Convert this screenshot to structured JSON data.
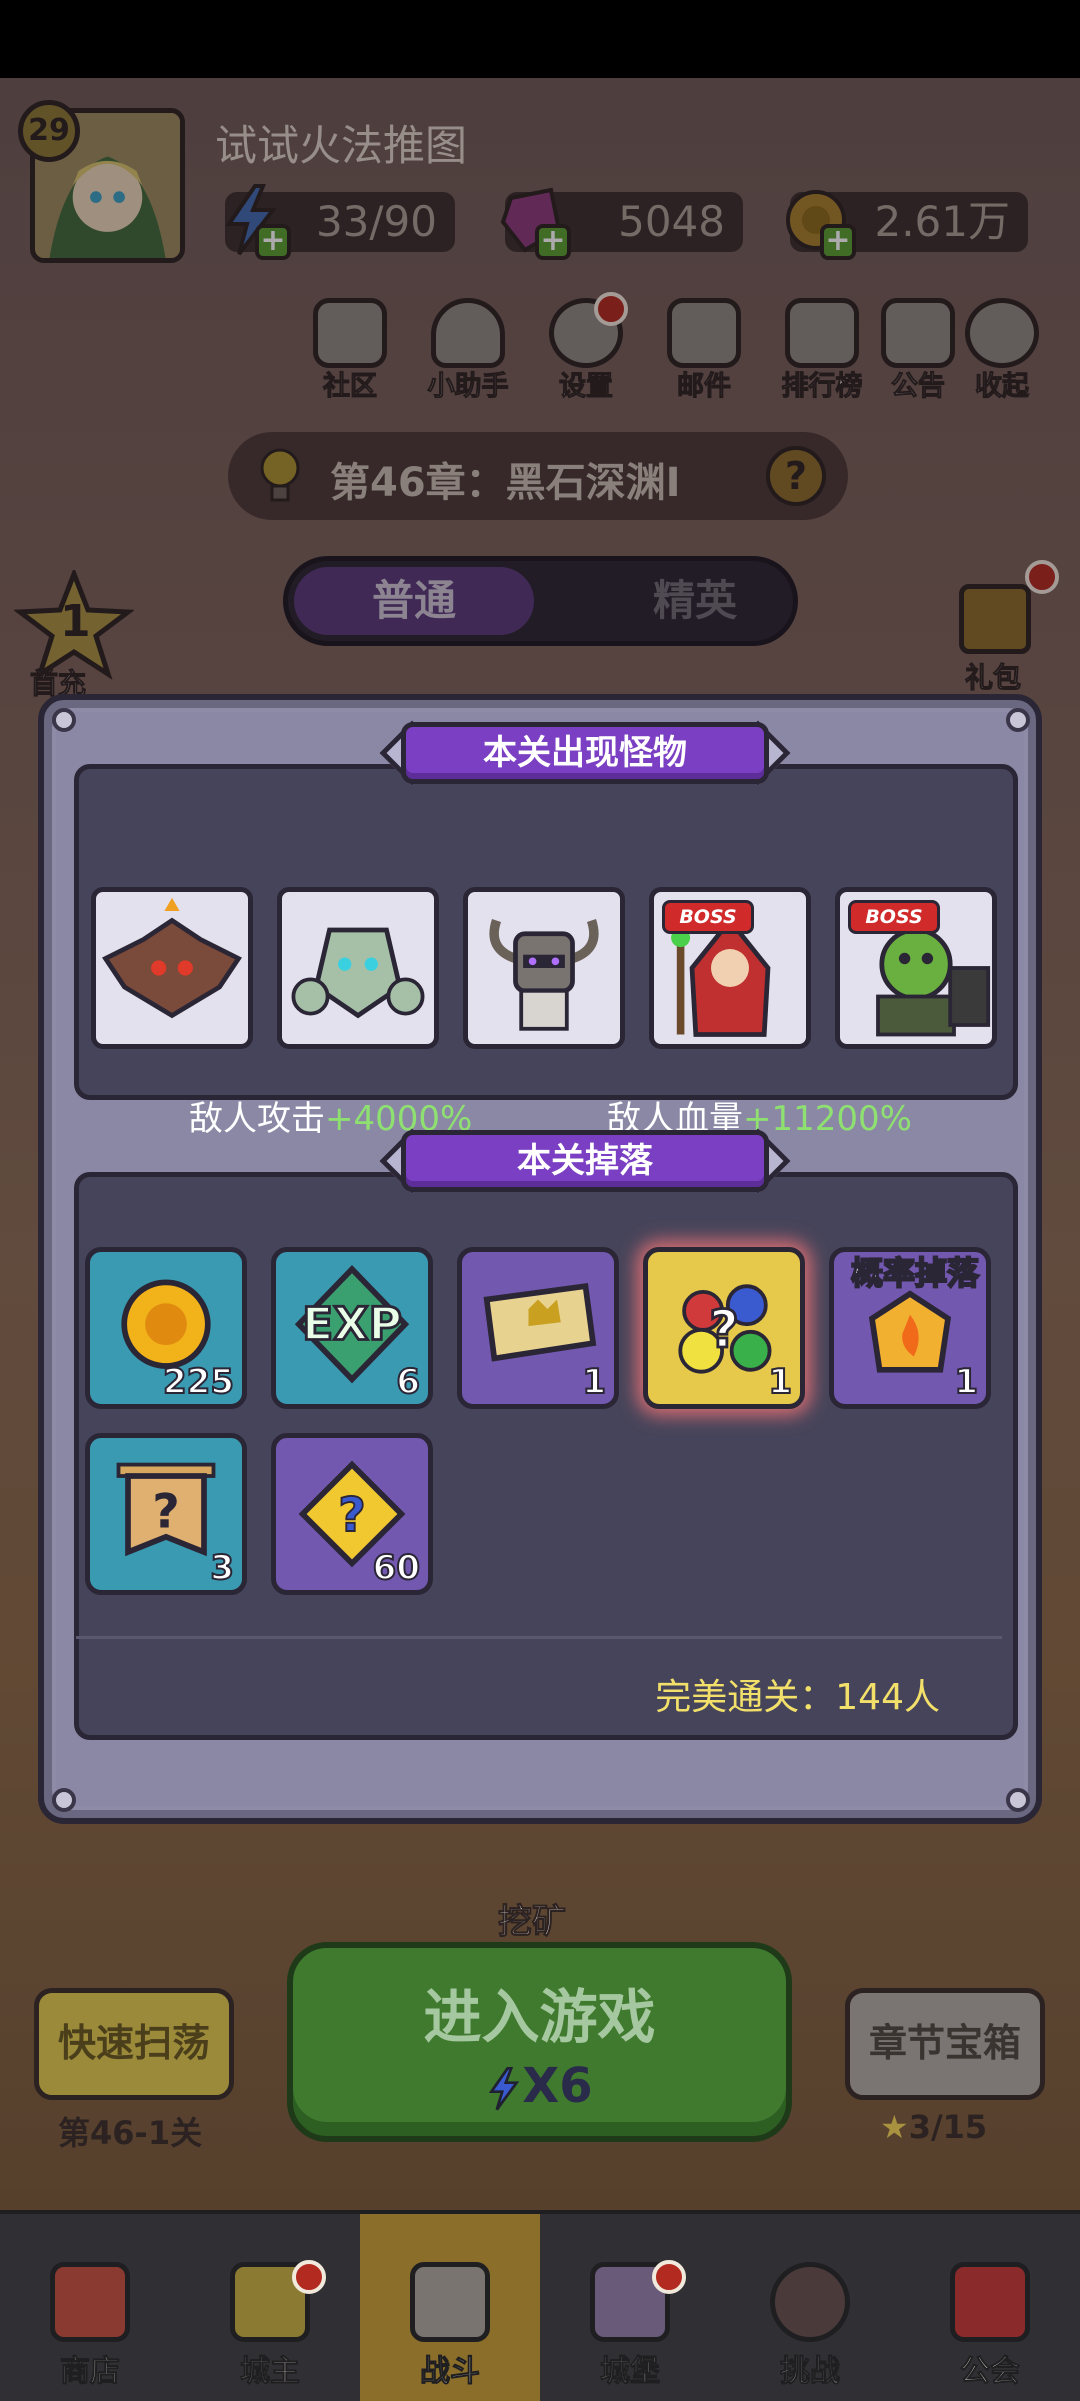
{
  "player": {
    "level": "29",
    "name": "试试火法推图"
  },
  "resources": {
    "energy": "33/90",
    "gems": "5048",
    "gold": "2.61万"
  },
  "quick_actions": [
    {
      "label": "社区",
      "icon": "community-icon"
    },
    {
      "label": "小助手",
      "icon": "assistant-robot-icon"
    },
    {
      "label": "设置",
      "icon": "gear-icon"
    },
    {
      "label": "邮件",
      "icon": "mail-icon"
    },
    {
      "label": "排行榜",
      "icon": "leaderboard-icon"
    },
    {
      "label": "公告",
      "icon": "announcement-icon"
    },
    {
      "label": "收起",
      "icon": "play-icon"
    }
  ],
  "chapter": {
    "title": "第46章：黑石深渊Ⅰ"
  },
  "mode": {
    "normal": "普通",
    "elite": "精英"
  },
  "side_left": {
    "star_number": "1",
    "label": "首充"
  },
  "side_right": {
    "label": "礼包"
  },
  "modal": {
    "monsters_title": "本关出现怪物",
    "monsters": [
      {
        "name": "bat-demon",
        "boss": false
      },
      {
        "name": "stone-golem",
        "boss": false
      },
      {
        "name": "horned-knight",
        "boss": false
      },
      {
        "name": "red-mage",
        "boss": true
      },
      {
        "name": "green-orc",
        "boss": true
      }
    ],
    "boss_tag": "BOSS",
    "enemy_attack_label": "敌人攻击",
    "enemy_attack_value": "+4000%",
    "enemy_hp_label": "敌人血量",
    "enemy_hp_value": "+11200%",
    "drops_title": "本关掉落",
    "drops": [
      {
        "item": "gold-coin",
        "count": "225",
        "frame": "teal"
      },
      {
        "item": "exp-gem",
        "count": "6",
        "frame": "teal"
      },
      {
        "item": "ticket",
        "count": "1",
        "frame": "purple"
      },
      {
        "item": "mystery-gem-bundle",
        "count": "1",
        "frame": "gold"
      },
      {
        "item": "fire-crystal",
        "count": "1",
        "frame": "purple"
      },
      {
        "item": "mystery-scroll",
        "count": "3",
        "frame": "teal"
      },
      {
        "item": "mystery-puzzle",
        "count": "60",
        "frame": "purple"
      }
    ],
    "probability_drop_tag": "概率掉落",
    "perfect_clear": "完美通关：144人"
  },
  "actions": {
    "mine_label": "挖矿",
    "sweep_label": "快速扫荡",
    "sweep_stage": "第46-1关",
    "enter_label": "进入游戏",
    "enter_cost": "X6",
    "chest_label": "章节宝箱",
    "chest_progress": "3/15"
  },
  "bottom_nav": [
    {
      "label": "商店",
      "icon": "shop-icon"
    },
    {
      "label": "城主",
      "icon": "crown-icon"
    },
    {
      "label": "战斗",
      "icon": "crossed-swords-icon"
    },
    {
      "label": "城堡",
      "icon": "castle-icon"
    },
    {
      "label": "挑战",
      "icon": "demon-icon"
    },
    {
      "label": "公会",
      "icon": "guild-banner-icon"
    }
  ],
  "colors": {
    "modal_bg": "#6a6781",
    "ribbon_purple": "#7a3fc2",
    "stat_plus_green": "#8ee070",
    "perfect_yellow": "#f2e06a",
    "enter_green": "#3f7a2e"
  }
}
